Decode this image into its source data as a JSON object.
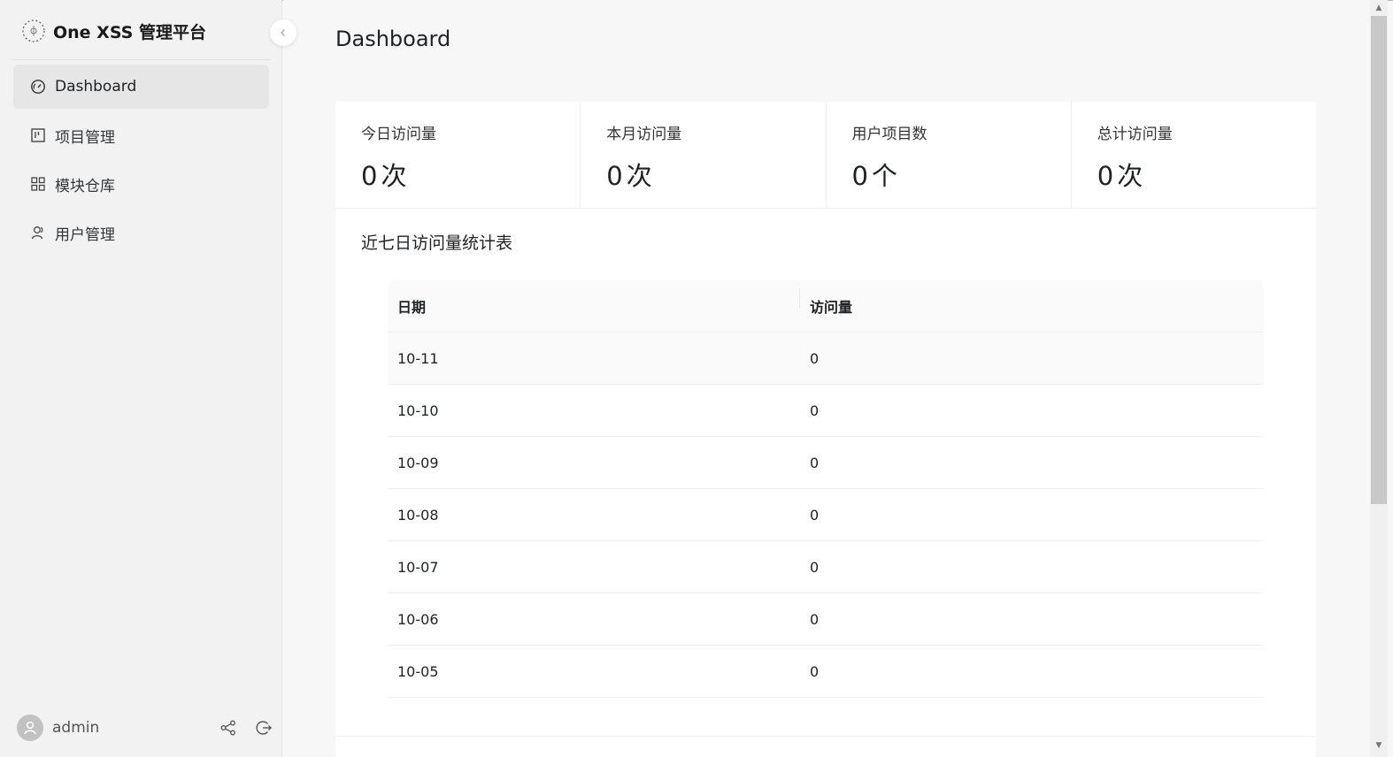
{
  "brand": {
    "title": "One XSS 管理平台"
  },
  "sidebar": {
    "items": [
      {
        "label": "Dashboard",
        "icon": "dashboard-icon",
        "active": true
      },
      {
        "label": "项目管理",
        "icon": "project-icon",
        "active": false
      },
      {
        "label": "模块仓库",
        "icon": "modules-icon",
        "active": false
      },
      {
        "label": "用户管理",
        "icon": "users-icon",
        "active": false
      }
    ],
    "user": {
      "name": "admin"
    }
  },
  "main": {
    "title": "Dashboard",
    "stats": [
      {
        "label": "今日访问量",
        "value": "0",
        "unit": "次"
      },
      {
        "label": "本月访问量",
        "value": "0",
        "unit": "次"
      },
      {
        "label": "用户项目数",
        "value": "0",
        "unit": "个"
      },
      {
        "label": "总计访问量",
        "value": "0",
        "unit": "次"
      }
    ],
    "table_title": "近七日访问量统计表",
    "table": {
      "headers": [
        "日期",
        "访问量"
      ],
      "rows": [
        [
          "10-11",
          "0"
        ],
        [
          "10-10",
          "0"
        ],
        [
          "10-09",
          "0"
        ],
        [
          "10-08",
          "0"
        ],
        [
          "10-07",
          "0"
        ],
        [
          "10-06",
          "0"
        ],
        [
          "10-05",
          "0"
        ]
      ]
    }
  },
  "colors": {
    "sidebar_bg": "#f2f2f2",
    "active_item_bg": "#e6e6e6",
    "main_bg": "#f7f7f7"
  }
}
